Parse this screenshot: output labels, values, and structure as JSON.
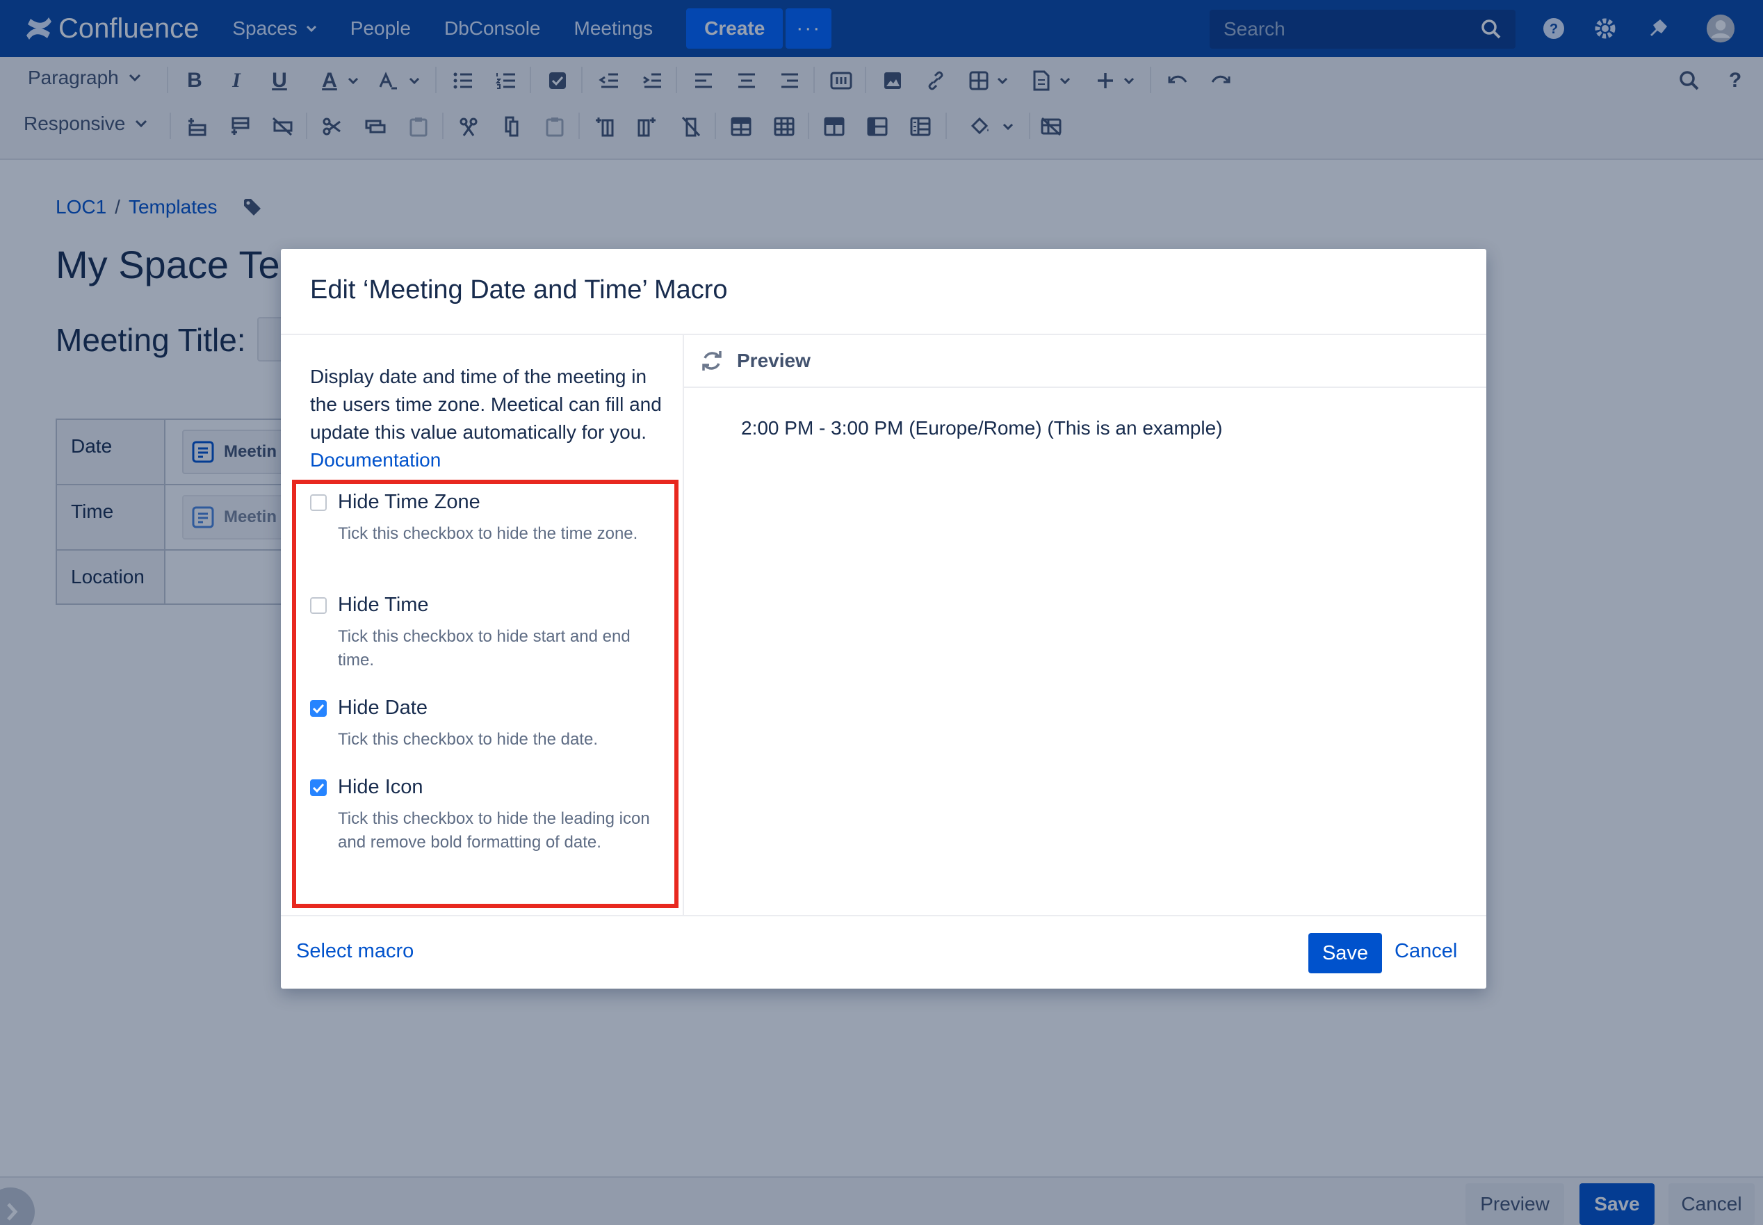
{
  "nav": {
    "app_name": "Confluence",
    "links": [
      "Spaces",
      "People",
      "DbConsole",
      "Meetings"
    ],
    "create_label": "Create",
    "more_label": "···",
    "search_placeholder": "Search"
  },
  "toolbar": {
    "paragraph_label": "Paragraph",
    "responsive_label": "Responsive",
    "bold": "B",
    "italic": "I",
    "underline": "U",
    "text_color": "A",
    "help": "?"
  },
  "page": {
    "breadcrumb": [
      "LOC1",
      "Templates"
    ],
    "breadcrumb_separator": "/",
    "title": "My Space Ter",
    "meeting_title_label": "Meeting Title:",
    "table": {
      "rows": [
        {
          "label": "Date",
          "macro": "Meetin"
        },
        {
          "label": "Time",
          "macro": "Meetin"
        },
        {
          "label": "Location",
          "macro": ""
        }
      ]
    }
  },
  "bottom_bar": {
    "preview_label": "Preview",
    "save_label": "Save",
    "cancel_label": "Cancel"
  },
  "dialog": {
    "title": "Edit ‘Meeting Date and Time’ Macro",
    "description": "Display date and time of the meeting in the users time zone. Meetical can fill and update this value automatically for you.",
    "documentation_link": "Documentation",
    "options": [
      {
        "label": "Hide Time Zone",
        "help": "Tick this checkbox to hide the time zone.",
        "checked": false
      },
      {
        "label": "Hide Time",
        "help": "Tick this checkbox to hide start and end time.",
        "checked": false
      },
      {
        "label": "Hide Date",
        "help": "Tick this checkbox to hide the date.",
        "checked": true
      },
      {
        "label": "Hide Icon",
        "help": "Tick this checkbox to hide the leading icon and remove bold formatting of date.",
        "checked": true
      }
    ],
    "preview_heading": "Preview",
    "preview_text": "2:00 PM - 3:00 PM (Europe/Rome) (This is an example)",
    "select_macro_label": "Select macro",
    "save_label": "Save",
    "cancel_label": "Cancel"
  },
  "colors": {
    "nav_bg": "#0747a6",
    "primary": "#0052cc",
    "checkbox_checked": "#2684ff",
    "highlight": "#e8281f"
  }
}
